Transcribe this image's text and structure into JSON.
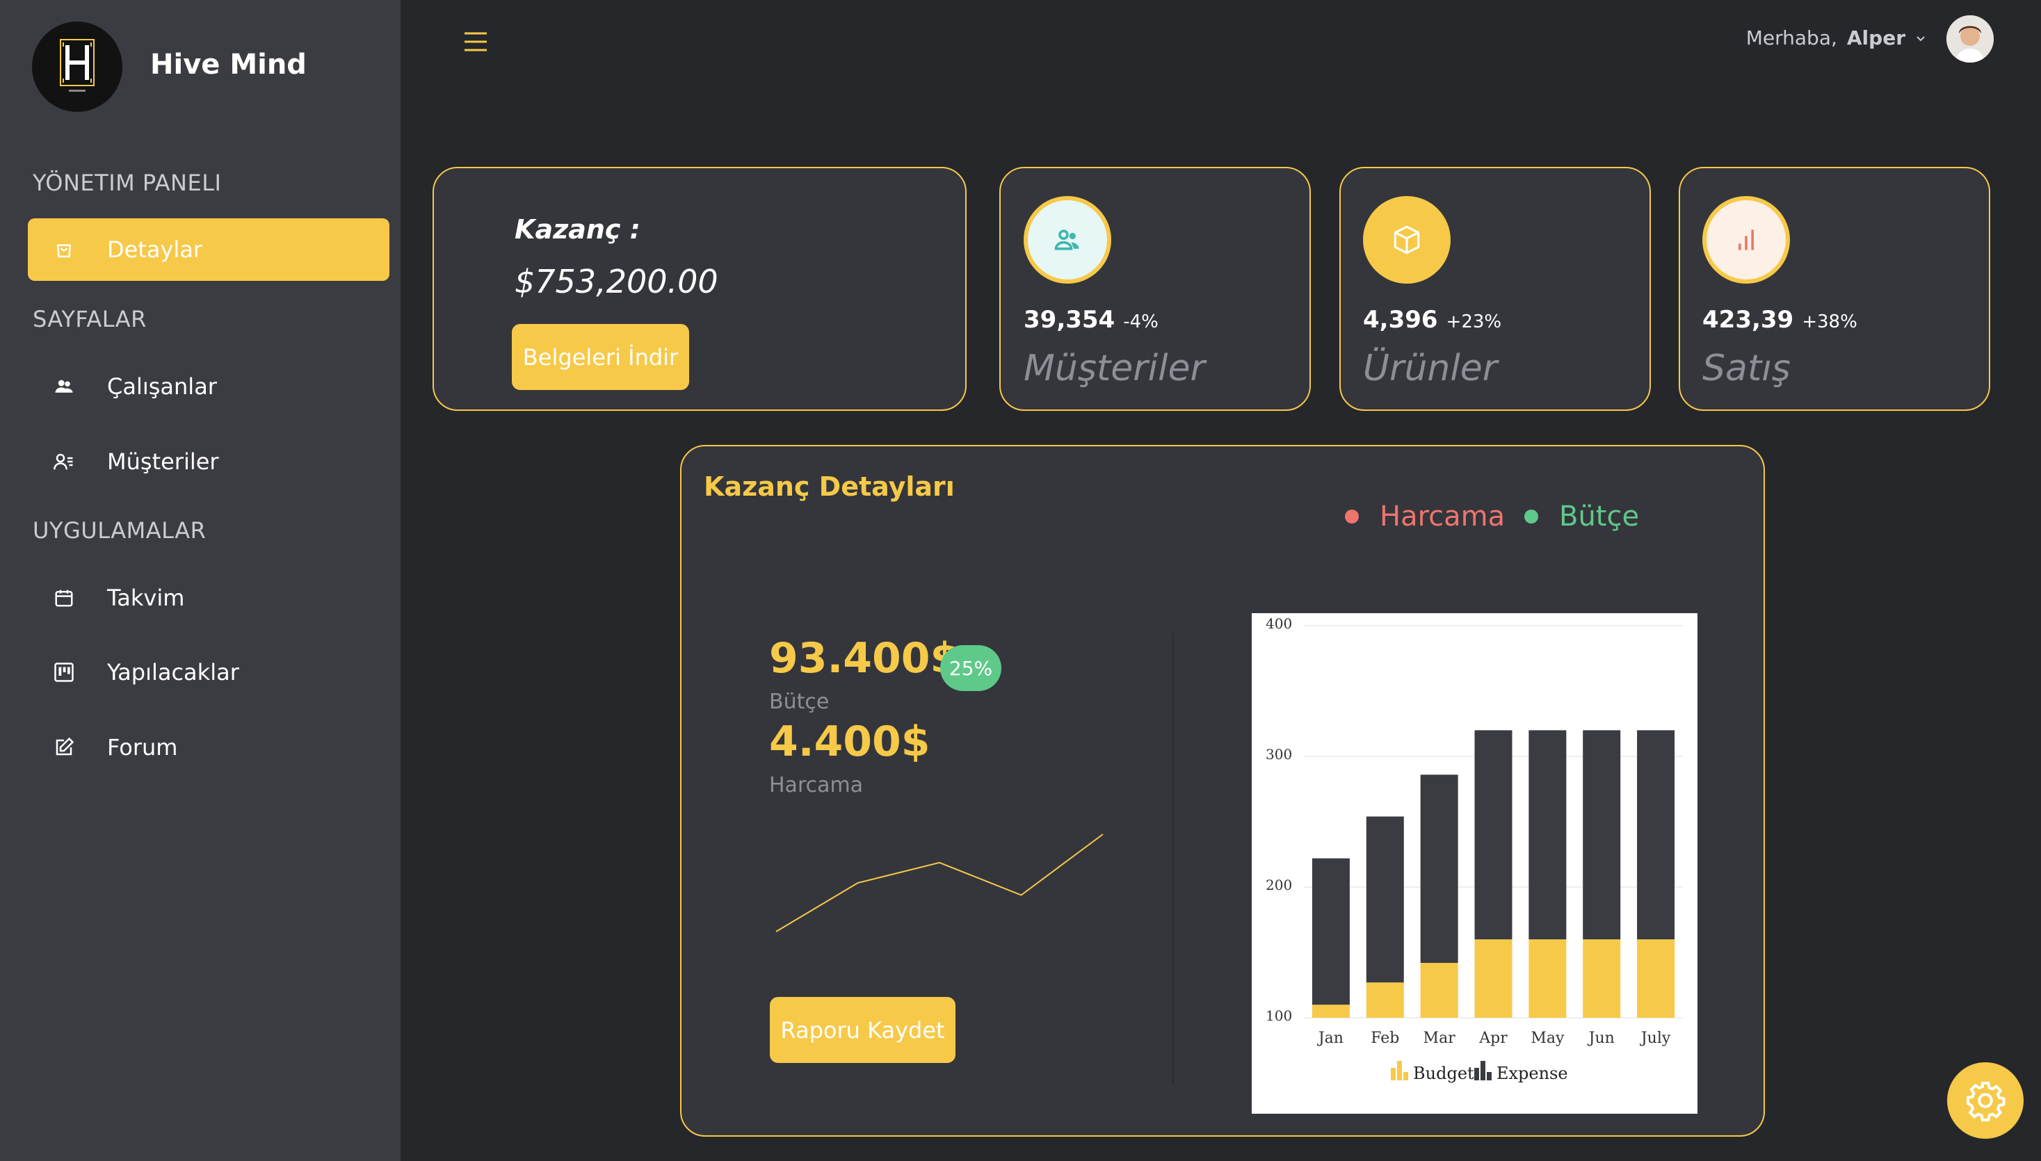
{
  "brand": {
    "name": "Hive Mind"
  },
  "sidebar": {
    "section_dashboard": "YÖNETIM PANELI",
    "section_pages": "SAYFALAR",
    "section_apps": "UYGULAMALAR",
    "items": [
      {
        "label": "Detaylar",
        "icon": "shopping-bag-icon",
        "active": true
      },
      {
        "label": "Çalışanlar",
        "icon": "team-icon",
        "active": false
      },
      {
        "label": "Müşteriler",
        "icon": "contacts-icon",
        "active": false
      },
      {
        "label": "Takvim",
        "icon": "calendar-icon",
        "active": false
      },
      {
        "label": "Yapılacaklar",
        "icon": "kanban-icon",
        "active": false
      },
      {
        "label": "Forum",
        "icon": "edit-icon",
        "active": false
      }
    ]
  },
  "header": {
    "greeting": "Merhaba,",
    "user_name": "Alper"
  },
  "earnings_card": {
    "title": "Kazanç :",
    "value": "$753,200.00",
    "button": "Belgeleri İndir"
  },
  "stats": [
    {
      "value": "39,354",
      "change": "-4%",
      "label": "Müşteriler",
      "icon": "users-icon"
    },
    {
      "value": "4,396",
      "change": "+23%",
      "label": "Ürünler",
      "icon": "box-icon"
    },
    {
      "value": "423,39",
      "change": "+38%",
      "label": "Satış",
      "icon": "bar-chart-icon"
    }
  ],
  "details": {
    "title": "Kazanç Detayları",
    "legend": [
      {
        "label": "Harcama",
        "color": "#f0746e"
      },
      {
        "label": "Bütçe",
        "color": "#5fc98a"
      }
    ],
    "budget_value": "93.400$",
    "budget_badge": "25%",
    "budget_label": "Bütçe",
    "expense_value": "4.400$",
    "expense_label": "Harcama",
    "save_button": "Raporu Kaydet"
  },
  "colors": {
    "accent": "#f7c948",
    "sidebar": "#3a3c41",
    "background": "#26272b",
    "card": "#34363b"
  },
  "chart_data": {
    "type": "bar",
    "stacked": true,
    "categories": [
      "Jan",
      "Feb",
      "Mar",
      "Apr",
      "May",
      "Jun",
      "July"
    ],
    "series": [
      {
        "name": "Budget",
        "values": [
          110,
          127,
          142,
          160,
          160,
          160,
          160
        ],
        "color": "#f7c948"
      },
      {
        "name": "Expense",
        "values": [
          112,
          127,
          144,
          160,
          160,
          160,
          160
        ],
        "color": "#3a3c41"
      }
    ],
    "ylim": [
      100,
      400
    ],
    "yticks": [
      100,
      200,
      300,
      400
    ],
    "legend_position": "bottom",
    "grid": true
  },
  "sparkline": {
    "values": [
      2,
      14,
      19,
      11,
      26
    ]
  }
}
